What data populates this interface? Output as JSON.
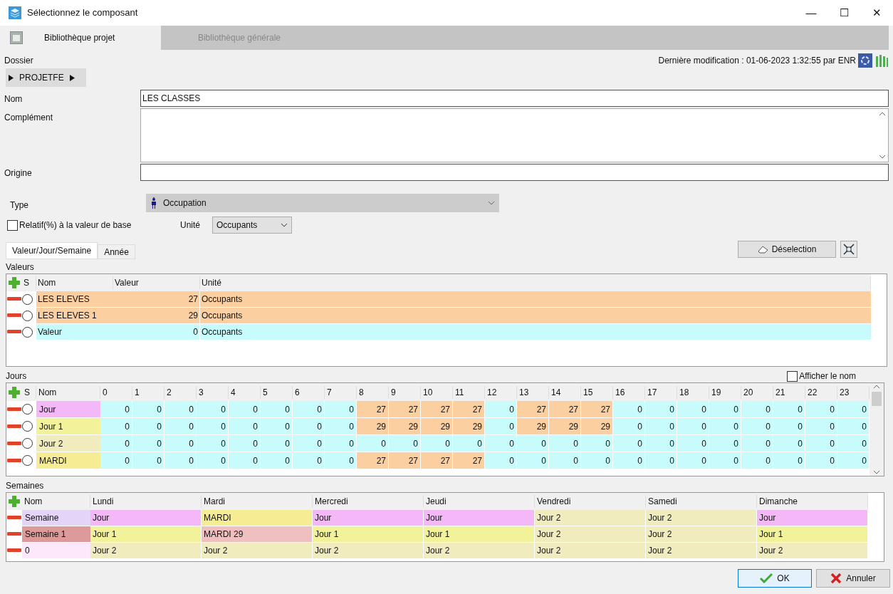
{
  "window": {
    "title": "Sélectionnez le composant",
    "controls": [
      "—",
      "☐",
      "✕"
    ]
  },
  "tabs": [
    {
      "label": "Bibliothèque projet",
      "selected": true
    },
    {
      "label": "Bibliothèque générale",
      "selected": false
    }
  ],
  "dossier": {
    "label": "Dossier",
    "path": "PROJETFE"
  },
  "last_modified": "Dernière modification : 01-06-2023 1:32:55 par ENR",
  "fields": [
    {
      "label": "Nom",
      "value": "LES CLASSES",
      "kind": "line"
    },
    {
      "label": "Complément",
      "kind": "area"
    },
    {
      "label": "Origine",
      "kind": "line"
    }
  ],
  "type": {
    "label": "Type",
    "value": "Occupation"
  },
  "relative": {
    "label": "Relatif(%) à la valeur de base",
    "checked": false
  },
  "unit": {
    "label": "Unité",
    "value": "Occupants"
  },
  "subtabs": [
    {
      "label": "Valeur/Jour/Semaine",
      "selected": true
    },
    {
      "label": "Année",
      "selected": false
    }
  ],
  "deselect_button": "Déselection",
  "values": {
    "title": "Valeurs",
    "columns": [
      "S",
      "Nom",
      "Valeur",
      "Unité"
    ],
    "rows": [
      {
        "name": "LES ELEVES",
        "value": "27",
        "unit": "Occupants",
        "color": "#fbcf9f",
        "selected": false
      },
      {
        "name": "LES ELEVES 1",
        "value": "29",
        "unit": "Occupants",
        "color": "#fbcf9f",
        "selected": false
      },
      {
        "name": "Valeur",
        "value": "0",
        "unit": "Occupants",
        "color": "#c8fcfc",
        "selected": false
      }
    ]
  },
  "days": {
    "title": "Jours",
    "show_name": {
      "label": "Afficher le nom",
      "checked": false
    },
    "columns": [
      "S",
      "Nom",
      "0",
      "1",
      "2",
      "3",
      "4",
      "5",
      "6",
      "7",
      "8",
      "9",
      "10",
      "11",
      "12",
      "13",
      "14",
      "15",
      "16",
      "17",
      "18",
      "19",
      "20",
      "21",
      "22",
      "23"
    ],
    "rows": [
      {
        "name": "Jour",
        "color": "#f4b8f8",
        "selected": false,
        "cells": [
          {
            "value": "0",
            "active": false
          },
          {
            "value": "0",
            "active": false
          },
          {
            "value": "0",
            "active": false
          },
          {
            "value": "0",
            "active": false
          },
          {
            "value": "0",
            "active": false
          },
          {
            "value": "0",
            "active": false
          },
          {
            "value": "0",
            "active": false
          },
          {
            "value": "0",
            "active": false
          },
          {
            "value": "27",
            "active": true
          },
          {
            "value": "27",
            "active": true
          },
          {
            "value": "27",
            "active": true
          },
          {
            "value": "27",
            "active": true
          },
          {
            "value": "0",
            "active": false
          },
          {
            "value": "27",
            "active": true
          },
          {
            "value": "27",
            "active": true
          },
          {
            "value": "27",
            "active": true
          },
          {
            "value": "0",
            "active": false
          },
          {
            "value": "0",
            "active": false
          },
          {
            "value": "0",
            "active": false
          },
          {
            "value": "0",
            "active": false
          },
          {
            "value": "0",
            "active": false
          },
          {
            "value": "0",
            "active": false
          },
          {
            "value": "0",
            "active": false
          },
          {
            "value": "0",
            "active": false
          }
        ]
      },
      {
        "name": "Jour 1",
        "color": "#f2f29a",
        "selected": false,
        "cells": [
          {
            "value": "0",
            "active": false
          },
          {
            "value": "0",
            "active": false
          },
          {
            "value": "0",
            "active": false
          },
          {
            "value": "0",
            "active": false
          },
          {
            "value": "0",
            "active": false
          },
          {
            "value": "0",
            "active": false
          },
          {
            "value": "0",
            "active": false
          },
          {
            "value": "0",
            "active": false
          },
          {
            "value": "29",
            "active": true
          },
          {
            "value": "29",
            "active": true
          },
          {
            "value": "29",
            "active": true
          },
          {
            "value": "29",
            "active": true
          },
          {
            "value": "0",
            "active": false
          },
          {
            "value": "29",
            "active": true
          },
          {
            "value": "29",
            "active": true
          },
          {
            "value": "29",
            "active": true
          },
          {
            "value": "0",
            "active": false
          },
          {
            "value": "0",
            "active": false
          },
          {
            "value": "0",
            "active": false
          },
          {
            "value": "0",
            "active": false
          },
          {
            "value": "0",
            "active": false
          },
          {
            "value": "0",
            "active": false
          },
          {
            "value": "0",
            "active": false
          },
          {
            "value": "0",
            "active": false
          }
        ]
      },
      {
        "name": "Jour 2",
        "color": "#f0ecbe",
        "selected": false,
        "cells": [
          {
            "value": "0",
            "active": false
          },
          {
            "value": "0",
            "active": false
          },
          {
            "value": "0",
            "active": false
          },
          {
            "value": "0",
            "active": false
          },
          {
            "value": "0",
            "active": false
          },
          {
            "value": "0",
            "active": false
          },
          {
            "value": "0",
            "active": false
          },
          {
            "value": "0",
            "active": false
          },
          {
            "value": "0",
            "active": false
          },
          {
            "value": "0",
            "active": false
          },
          {
            "value": "0",
            "active": false
          },
          {
            "value": "0",
            "active": false
          },
          {
            "value": "0",
            "active": false
          },
          {
            "value": "0",
            "active": false
          },
          {
            "value": "0",
            "active": false
          },
          {
            "value": "0",
            "active": false
          },
          {
            "value": "0",
            "active": false
          },
          {
            "value": "0",
            "active": false
          },
          {
            "value": "0",
            "active": false
          },
          {
            "value": "0",
            "active": false
          },
          {
            "value": "0",
            "active": false
          },
          {
            "value": "0",
            "active": false
          },
          {
            "value": "0",
            "active": false
          },
          {
            "value": "0",
            "active": false
          }
        ]
      },
      {
        "name": "MARDI",
        "color": "#f5ec94",
        "selected": false,
        "cells": [
          {
            "value": "0",
            "active": false
          },
          {
            "value": "0",
            "active": false
          },
          {
            "value": "0",
            "active": false
          },
          {
            "value": "0",
            "active": false
          },
          {
            "value": "0",
            "active": false
          },
          {
            "value": "0",
            "active": false
          },
          {
            "value": "0",
            "active": false
          },
          {
            "value": "0",
            "active": false
          },
          {
            "value": "27",
            "active": true
          },
          {
            "value": "27",
            "active": true
          },
          {
            "value": "27",
            "active": true
          },
          {
            "value": "27",
            "active": true
          },
          {
            "value": "0",
            "active": false
          },
          {
            "value": "0",
            "active": false
          },
          {
            "value": "0",
            "active": false
          },
          {
            "value": "0",
            "active": false
          },
          {
            "value": "0",
            "active": false
          },
          {
            "value": "0",
            "active": false
          },
          {
            "value": "0",
            "active": false
          },
          {
            "value": "0",
            "active": false
          },
          {
            "value": "0",
            "active": false
          },
          {
            "value": "0",
            "active": false
          },
          {
            "value": "0",
            "active": false
          },
          {
            "value": "0",
            "active": false
          }
        ]
      }
    ]
  },
  "weeks": {
    "title": "Semaines",
    "columns": [
      "Nom",
      "Lundi",
      "Mardi",
      "Mercredi",
      "Jeudi",
      "Vendredi",
      "Samedi",
      "Dimanche"
    ],
    "rows": [
      {
        "name": "Semaine",
        "color": "#e4d4f8",
        "days": [
          {
            "text": "Jour",
            "color": "#f4b8f8"
          },
          {
            "text": "MARDI",
            "color": "#f5ec94"
          },
          {
            "text": "Jour",
            "color": "#f4b8f8"
          },
          {
            "text": "Jour",
            "color": "#f4b8f8"
          },
          {
            "text": "Jour 2",
            "color": "#f0ecbe"
          },
          {
            "text": "Jour 2",
            "color": "#f0ecbe"
          },
          {
            "text": "Jour",
            "color": "#f4b8f8"
          }
        ]
      },
      {
        "name": "Semaine 1",
        "color": "#dc9a9a",
        "days": [
          {
            "text": "Jour 1",
            "color": "#f2f29a"
          },
          {
            "text": "MARDI 29",
            "color": "#f0c0c0"
          },
          {
            "text": "Jour 1",
            "color": "#f2f29a"
          },
          {
            "text": "Jour 1",
            "color": "#f2f29a"
          },
          {
            "text": "Jour 2",
            "color": "#f0ecbe"
          },
          {
            "text": "Jour 2",
            "color": "#f0ecbe"
          },
          {
            "text": "Jour 1",
            "color": "#f2f29a"
          }
        ]
      },
      {
        "name": "0",
        "color": "#fde8fb",
        "days": [
          {
            "text": "Jour 2",
            "color": "#f0ecbe"
          },
          {
            "text": "Jour 2",
            "color": "#f0ecbe"
          },
          {
            "text": "Jour 2",
            "color": "#f0ecbe"
          },
          {
            "text": "Jour 2",
            "color": "#f0ecbe"
          },
          {
            "text": "Jour 2",
            "color": "#f0ecbe"
          },
          {
            "text": "Jour 2",
            "color": "#f0ecbe"
          },
          {
            "text": "Jour 2",
            "color": "#f0ecbe"
          }
        ]
      }
    ]
  },
  "buttons": [
    {
      "label": "OK",
      "kind": "ok"
    },
    {
      "label": "Annuler",
      "kind": "cancel"
    }
  ]
}
